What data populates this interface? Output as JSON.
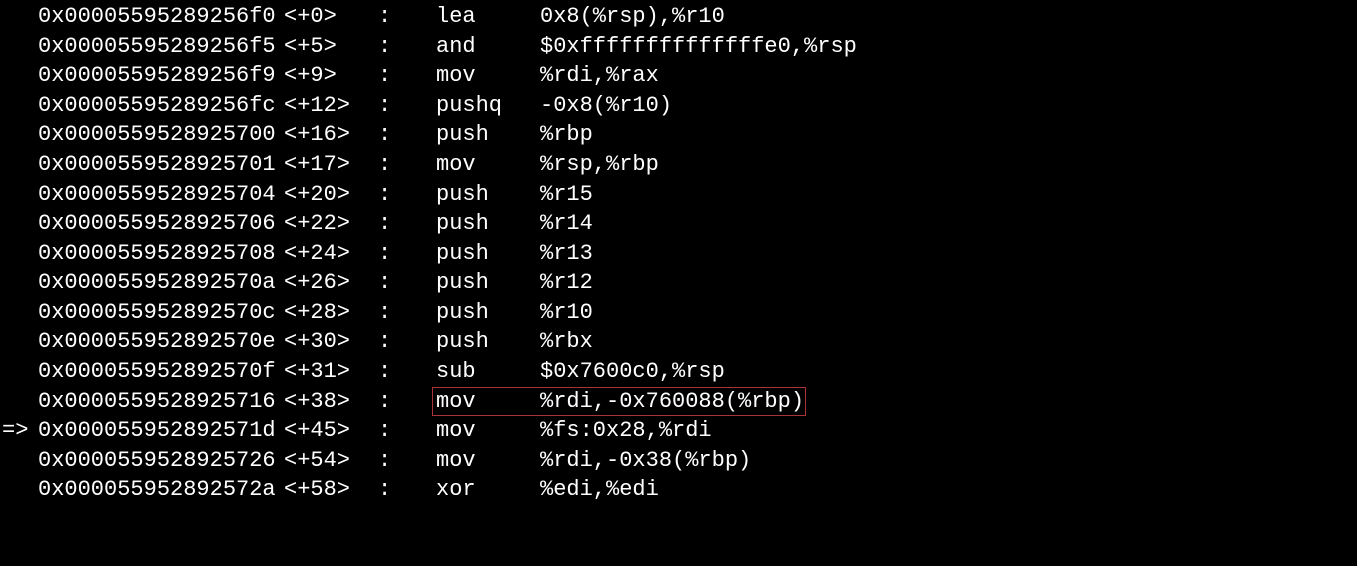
{
  "current_marker": "=>",
  "current_index": 14,
  "highlight_index": 13,
  "lines": [
    {
      "address": "0x00005595289256f0",
      "offset": "<+0>",
      "mnemonic": "lea",
      "operands": "0x8(%rsp),%r10"
    },
    {
      "address": "0x00005595289256f5",
      "offset": "<+5>",
      "mnemonic": "and",
      "operands": "$0xffffffffffffffe0,%rsp"
    },
    {
      "address": "0x00005595289256f9",
      "offset": "<+9>",
      "mnemonic": "mov",
      "operands": "%rdi,%rax"
    },
    {
      "address": "0x00005595289256fc",
      "offset": "<+12>",
      "mnemonic": "pushq",
      "operands": "-0x8(%r10)"
    },
    {
      "address": "0x0000559528925700",
      "offset": "<+16>",
      "mnemonic": "push",
      "operands": "%rbp"
    },
    {
      "address": "0x0000559528925701",
      "offset": "<+17>",
      "mnemonic": "mov",
      "operands": "%rsp,%rbp"
    },
    {
      "address": "0x0000559528925704",
      "offset": "<+20>",
      "mnemonic": "push",
      "operands": "%r15"
    },
    {
      "address": "0x0000559528925706",
      "offset": "<+22>",
      "mnemonic": "push",
      "operands": "%r14"
    },
    {
      "address": "0x0000559528925708",
      "offset": "<+24>",
      "mnemonic": "push",
      "operands": "%r13"
    },
    {
      "address": "0x000055952892570a",
      "offset": "<+26>",
      "mnemonic": "push",
      "operands": "%r12"
    },
    {
      "address": "0x000055952892570c",
      "offset": "<+28>",
      "mnemonic": "push",
      "operands": "%r10"
    },
    {
      "address": "0x000055952892570e",
      "offset": "<+30>",
      "mnemonic": "push",
      "operands": "%rbx"
    },
    {
      "address": "0x000055952892570f",
      "offset": "<+31>",
      "mnemonic": "sub",
      "operands": "$0x7600c0,%rsp"
    },
    {
      "address": "0x0000559528925716",
      "offset": "<+38>",
      "mnemonic": "mov",
      "operands": "%rdi,-0x760088(%rbp)"
    },
    {
      "address": "0x000055952892571d",
      "offset": "<+45>",
      "mnemonic": "mov",
      "operands": "%fs:0x28,%rdi"
    },
    {
      "address": "0x0000559528925726",
      "offset": "<+54>",
      "mnemonic": "mov",
      "operands": "%rdi,-0x38(%rbp)"
    },
    {
      "address": "0x000055952892572a",
      "offset": "<+58>",
      "mnemonic": "xor",
      "operands": "%edi,%edi"
    }
  ]
}
